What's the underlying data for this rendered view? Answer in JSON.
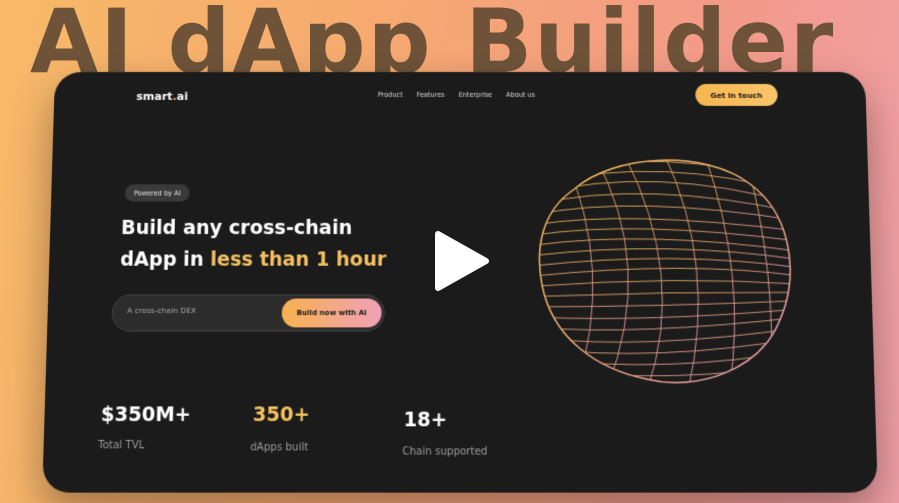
{
  "banner": {
    "title": "AI dApp Builder"
  },
  "header": {
    "logo_text": "smart",
    "logo_dot": ".",
    "logo_suffix": "ai",
    "nav": [
      "Product",
      "Features",
      "Enterprise",
      "About us"
    ],
    "cta_label": "Get in touch"
  },
  "hero": {
    "badge": "Powered by AI",
    "line1": "Build any cross-chain",
    "line2_prefix": "dApp in ",
    "line2_accent": "less than 1 hour",
    "input_placeholder": "A cross-chain DEX",
    "button_label": "Build now with AI"
  },
  "stats": [
    {
      "value": "$350M+",
      "label": "Total TVL"
    },
    {
      "value": "350+",
      "label": "dApps built"
    },
    {
      "value": "18+",
      "label": "Chain supported"
    }
  ],
  "colors": {
    "accent": "#f4c060",
    "card": "#1b1b1b",
    "title": "#6e5338"
  },
  "icons": {
    "play": "play-icon",
    "sphere": "sphere-illustration"
  }
}
